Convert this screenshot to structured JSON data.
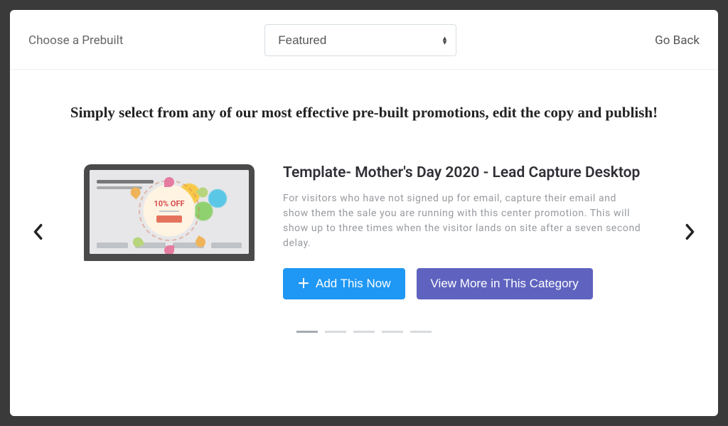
{
  "header": {
    "title": "Choose a Prebuilt",
    "filter_selected": "Featured",
    "go_back": "Go Back"
  },
  "headline": "Simply select from any of our most effective pre-built promotions, edit the copy and publish!",
  "slide": {
    "title": "Template- Mother's Day 2020 - Lead Capture Desktop",
    "description": "For visitors who have not signed up for email, capture their email and show them the sale you are running with this center promotion. This will show up to three times when the visitor lands on site after a seven second delay.",
    "badge_text": "10% OFF",
    "add_button": "Add This Now",
    "view_button": "View More in This Category"
  },
  "pagination": {
    "total": 5,
    "active": 1
  }
}
